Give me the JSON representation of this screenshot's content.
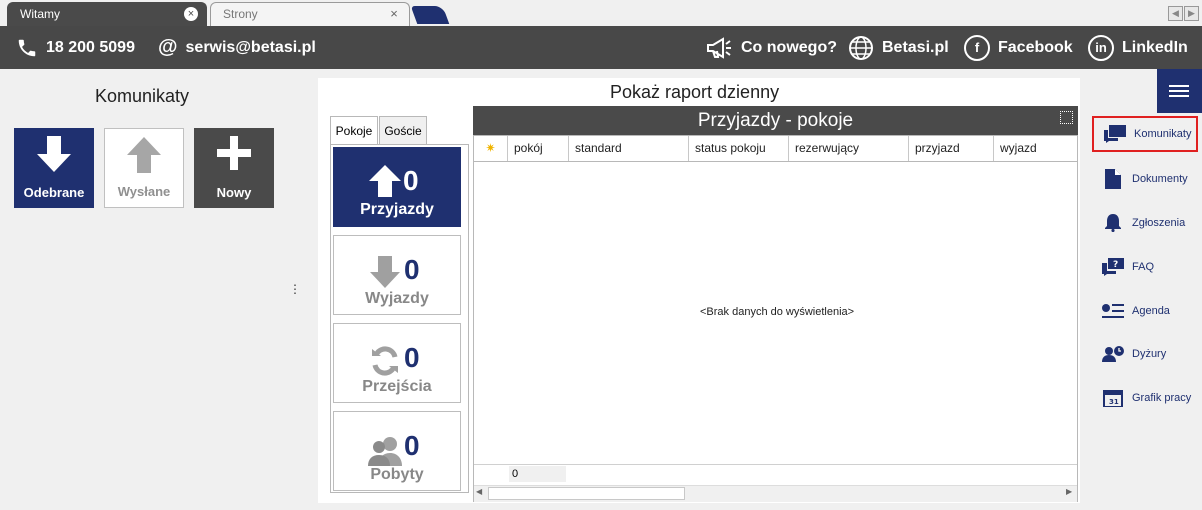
{
  "tabs": [
    {
      "label": "Witamy",
      "active": true,
      "close": "×"
    },
    {
      "label": "Strony",
      "active": false,
      "close": "×"
    }
  ],
  "scroll": {
    "left": "◀",
    "right": "▶"
  },
  "header": {
    "phone": "18 200 5099",
    "email": "serwis@betasi.pl",
    "news": "Co nowego?",
    "site": "Betasi.pl",
    "facebook": "Facebook",
    "linkedin": "LinkedIn",
    "icons": {
      "phone": "phone-icon",
      "email": "at-icon",
      "news": "megaphone-icon",
      "site": "globe-icon",
      "facebook": "facebook-icon",
      "linkedin": "linkedin-icon"
    }
  },
  "komunikaty": {
    "title": "Komunikaty",
    "buttons": [
      {
        "label": "Odebrane",
        "icon": "arrow-down-icon"
      },
      {
        "label": "Wysłane",
        "icon": "arrow-up-icon"
      },
      {
        "label": "Nowy",
        "icon": "plus-icon"
      }
    ]
  },
  "report": {
    "title": "Pokaż raport dzienny",
    "tabs": [
      "Pokoje",
      "Goście"
    ],
    "stats": [
      {
        "label": "Przyjazdy",
        "value": "0"
      },
      {
        "label": "Wyjazdy",
        "value": "0"
      },
      {
        "label": "Przejścia",
        "value": "0"
      },
      {
        "label": "Pobyty",
        "value": "0"
      }
    ],
    "grid": {
      "title": "Przyjazdy - pokoje",
      "columns": [
        "pokój",
        "standard",
        "status pokoju",
        "rezerwujący",
        "przyjazd",
        "wyjazd"
      ],
      "empty": "<Brak danych do wyświetlenia>",
      "footer_value": "0"
    }
  },
  "sidebar": [
    {
      "label": "Komunikaty",
      "icon": "chat-icon"
    },
    {
      "label": "Dokumenty",
      "icon": "document-icon"
    },
    {
      "label": "Zgłoszenia",
      "icon": "bell-icon"
    },
    {
      "label": "FAQ",
      "icon": "faq-icon"
    },
    {
      "label": "Agenda",
      "icon": "agenda-icon"
    },
    {
      "label": "Dyżury",
      "icon": "duty-icon"
    },
    {
      "label": "Grafik pracy",
      "icon": "calendar-icon"
    }
  ],
  "colors": {
    "navy": "#1f3070",
    "header": "#484848",
    "highlight": "#e02020"
  }
}
